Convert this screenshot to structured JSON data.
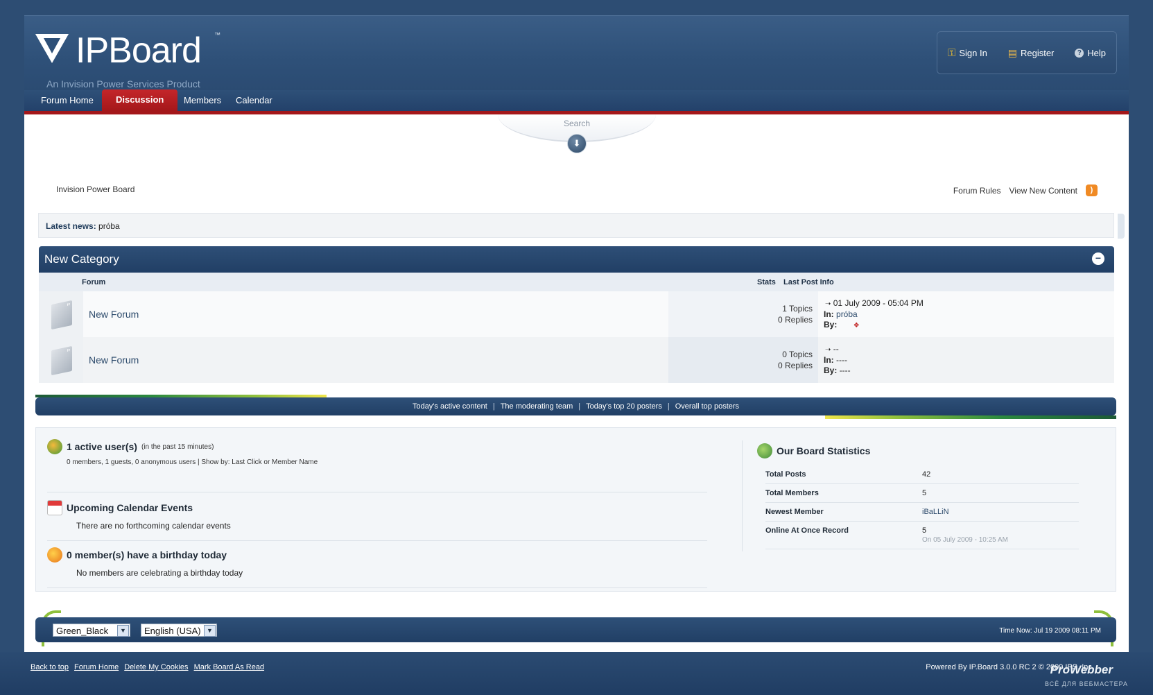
{
  "header": {
    "logo_name": "IPBoard",
    "logo_tm": "™",
    "logo_tag": "An Invision Power Services Product",
    "user_links": [
      "Sign In",
      "Register",
      "Help"
    ]
  },
  "nav": {
    "tabs": [
      "Forum Home",
      "Discussion",
      "Members",
      "Calendar"
    ],
    "active": "Discussion"
  },
  "search": {
    "label": "Search"
  },
  "breadcrumb": "Invision Power Board",
  "top_links": [
    "Forum Rules",
    "View New Content"
  ],
  "news": {
    "label": "Latest news:",
    "value": "próba"
  },
  "category": {
    "title": "New Category",
    "columns": {
      "forum": "Forum",
      "stats": "Stats",
      "last": "Last Post Info"
    },
    "forums": [
      {
        "name": "New Forum",
        "topics": "1 Topics",
        "replies": "0 Replies",
        "last_date": "01 July 2009 - 05:04 PM",
        "in_label": "In:",
        "in_value": "próba",
        "by_label": "By:",
        "by_value": ""
      },
      {
        "name": "New Forum",
        "topics": "0 Topics",
        "replies": "0 Replies",
        "last_date": "--",
        "in_label": "In:",
        "in_value": "----",
        "by_label": "By:",
        "by_value": "----"
      }
    ]
  },
  "stat_links": [
    "Today's active content",
    "The moderating team",
    "Today's top 20 posters",
    "Overall top posters"
  ],
  "active_users": {
    "title": "1 active user(s)",
    "sub": "(in the past 15 minutes)",
    "detail": "0 members, 1 guests, 0 anonymous users | Show by: Last Click or Member Name"
  },
  "calendar": {
    "title": "Upcoming Calendar Events",
    "text": "There are no forthcoming calendar events"
  },
  "birthday": {
    "title": "0 member(s) have a birthday today",
    "text": "No members are celebrating a birthday today"
  },
  "board_stats": {
    "title": "Our Board Statistics",
    "rows": [
      {
        "k": "Total Posts",
        "v": "42",
        "sub": ""
      },
      {
        "k": "Total Members",
        "v": "5",
        "sub": ""
      },
      {
        "k": "Newest Member",
        "v": "iBaLLiN",
        "sub": ""
      },
      {
        "k": "Online At Once Record",
        "v": "5",
        "sub": "On 05 July 2009 - 10:25 AM"
      }
    ]
  },
  "footer": {
    "skin": "Green_Black",
    "lang": "English (USA)",
    "time": "Time Now: Jul 19 2009 08:11 PM"
  },
  "bottom_links": [
    "Back to top",
    "Forum Home",
    "Delete My Cookies",
    "Mark Board As Read"
  ],
  "powered": "Powered By IP.Board 3.0.0 RC 2 © 2009  IPS, Inc.",
  "watermark": "ProWebber",
  "watermark_sub": "ВСЁ ДЛЯ ВЕБМАСТЕРА",
  "colors": {
    "accent_red": "#a4171a",
    "navy": "#2b4a70",
    "green": "#8fc03c"
  }
}
